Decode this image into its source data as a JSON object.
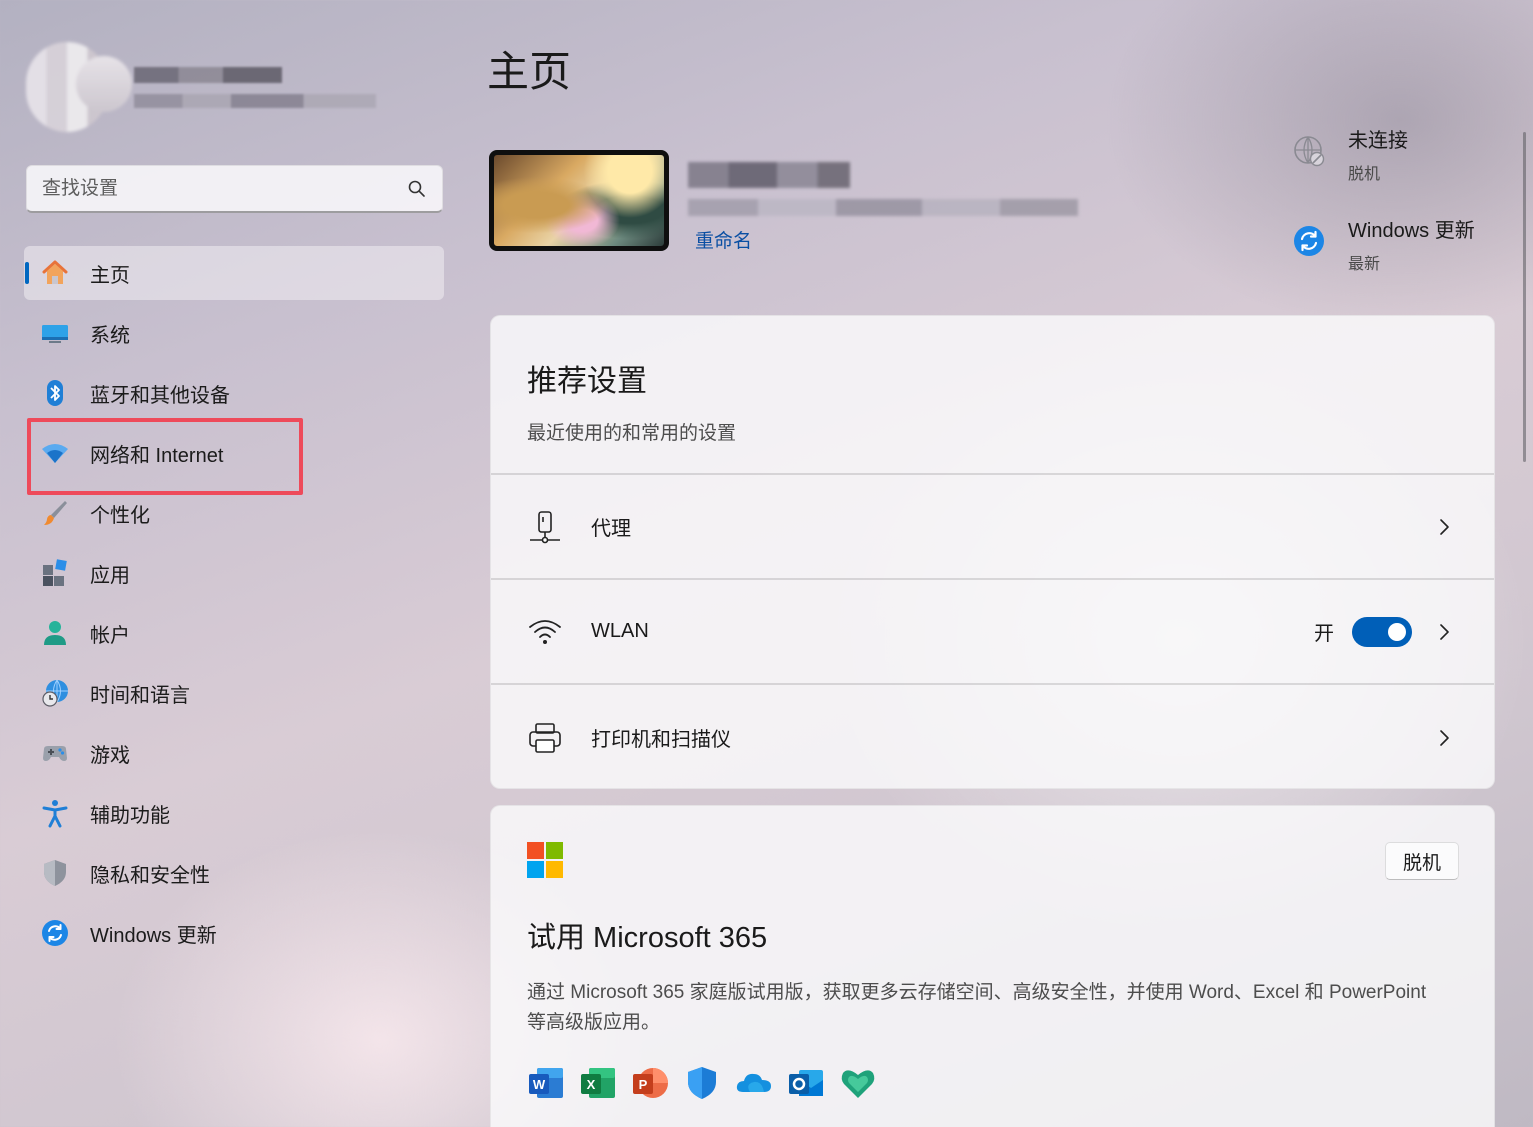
{
  "sidebar": {
    "search_placeholder": "查找设置",
    "items": [
      {
        "label": "主页",
        "icon": "home-icon"
      },
      {
        "label": "系统",
        "icon": "monitor-icon"
      },
      {
        "label": "蓝牙和其他设备",
        "icon": "bluetooth-icon"
      },
      {
        "label": "网络和 Internet",
        "icon": "wifi-icon"
      },
      {
        "label": "个性化",
        "icon": "brush-icon"
      },
      {
        "label": "应用",
        "icon": "apps-icon"
      },
      {
        "label": "帐户",
        "icon": "account-icon"
      },
      {
        "label": "时间和语言",
        "icon": "globe-clock-icon"
      },
      {
        "label": "游戏",
        "icon": "gamepad-icon"
      },
      {
        "label": "辅助功能",
        "icon": "accessibility-icon"
      },
      {
        "label": "隐私和安全性",
        "icon": "shield-icon"
      },
      {
        "label": "Windows 更新",
        "icon": "update-icon"
      }
    ],
    "active_item": "主页",
    "highlighted_item": "网络和 Internet"
  },
  "main": {
    "title": "主页",
    "device": {
      "rename_label": "重命名"
    },
    "status": [
      {
        "title": "未连接",
        "sub": "脱机",
        "icon": "globe-disconnected-icon"
      },
      {
        "title": "Windows 更新",
        "sub": "最新",
        "icon": "update-icon"
      }
    ],
    "recommended": {
      "title": "推荐设置",
      "subtitle": "最近使用的和常用的设置",
      "rows": [
        {
          "label": "代理",
          "icon": "proxy-icon"
        },
        {
          "label": "WLAN",
          "icon": "wifi-icon",
          "state": "开",
          "toggle_on": true
        },
        {
          "label": "打印机和扫描仪",
          "icon": "printer-icon"
        }
      ]
    },
    "m365": {
      "badge": "脱机",
      "title": "试用 Microsoft 365",
      "description": "通过 Microsoft 365 家庭版试用版，获取更多云存储空间、高级安全性，并使用 Word、Excel 和 PowerPoint 等高级版应用。",
      "apps": [
        "word-icon",
        "excel-icon",
        "powerpoint-icon",
        "defender-icon",
        "onedrive-icon",
        "outlook-icon",
        "family-safety-icon"
      ]
    }
  },
  "colors": {
    "accent": "#005fb8",
    "highlight_box": "#ee4a5a",
    "link": "#0a4fa3"
  }
}
